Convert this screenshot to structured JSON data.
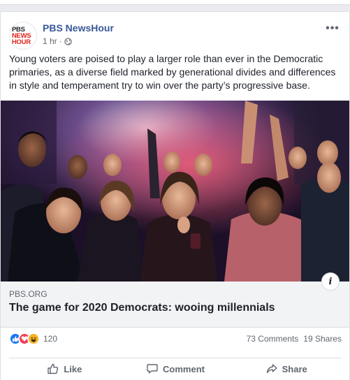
{
  "post": {
    "page_name": "PBS NewsHour",
    "time": "1 hr",
    "privacy_icon": "globe-icon",
    "more_icon": "more-options-icon",
    "avatar_logo": [
      "PBS",
      "NEWS",
      "HOUR"
    ],
    "text": "Young voters are poised to play a larger role than ever in the Democratic primaries, as a diverse field marked by generational divides and differences in style and temperament try to win over the party’s progressive base."
  },
  "link": {
    "domain": "PBS.ORG",
    "title": "The game for 2020 Democrats: wooing millennials",
    "info_icon": "i"
  },
  "stats": {
    "reaction_icons": [
      "like-reaction-icon",
      "love-reaction-icon",
      "haha-reaction-icon"
    ],
    "reaction_count": "120",
    "comments": "73 Comments",
    "shares": "19 Shares"
  },
  "actions": {
    "like": "Like",
    "comment": "Comment",
    "share": "Share"
  },
  "colors": {
    "page_name": "#385898",
    "like_blue": "#1877f2",
    "love_red": "#f33e58",
    "haha_yellow": "#f7b125",
    "logo_red": "#e2231a"
  }
}
